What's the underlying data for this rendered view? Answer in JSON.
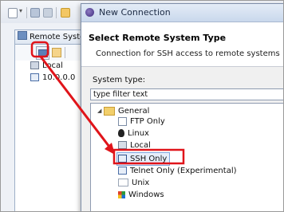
{
  "eclipse": {
    "view_tab_label": "Remote Syste",
    "tree": {
      "local": "Local",
      "host": "10.0.0.0"
    }
  },
  "dialog": {
    "title": "New Connection",
    "heading": "Select Remote System Type",
    "description": "Connection for SSH access to remote systems",
    "system_type_label": "System type:",
    "filter_placeholder": "type filter text",
    "tree": {
      "root": "General",
      "items": [
        {
          "label": "FTP Only",
          "icon": "ftp-icon"
        },
        {
          "label": "Linux",
          "icon": "linux-icon"
        },
        {
          "label": "Local",
          "icon": "local-icon"
        },
        {
          "label": "SSH Only",
          "icon": "ssh-icon",
          "selected": true
        },
        {
          "label": "Telnet Only (Experimental)",
          "icon": "telnet-icon"
        },
        {
          "label": "Unix",
          "icon": "unix-icon"
        },
        {
          "label": "Windows",
          "icon": "windows-icon"
        }
      ]
    }
  },
  "colors": {
    "highlight_red": "#e0141a",
    "selection_border": "#7fa4dc",
    "titlebar": "#c9d8ec"
  }
}
